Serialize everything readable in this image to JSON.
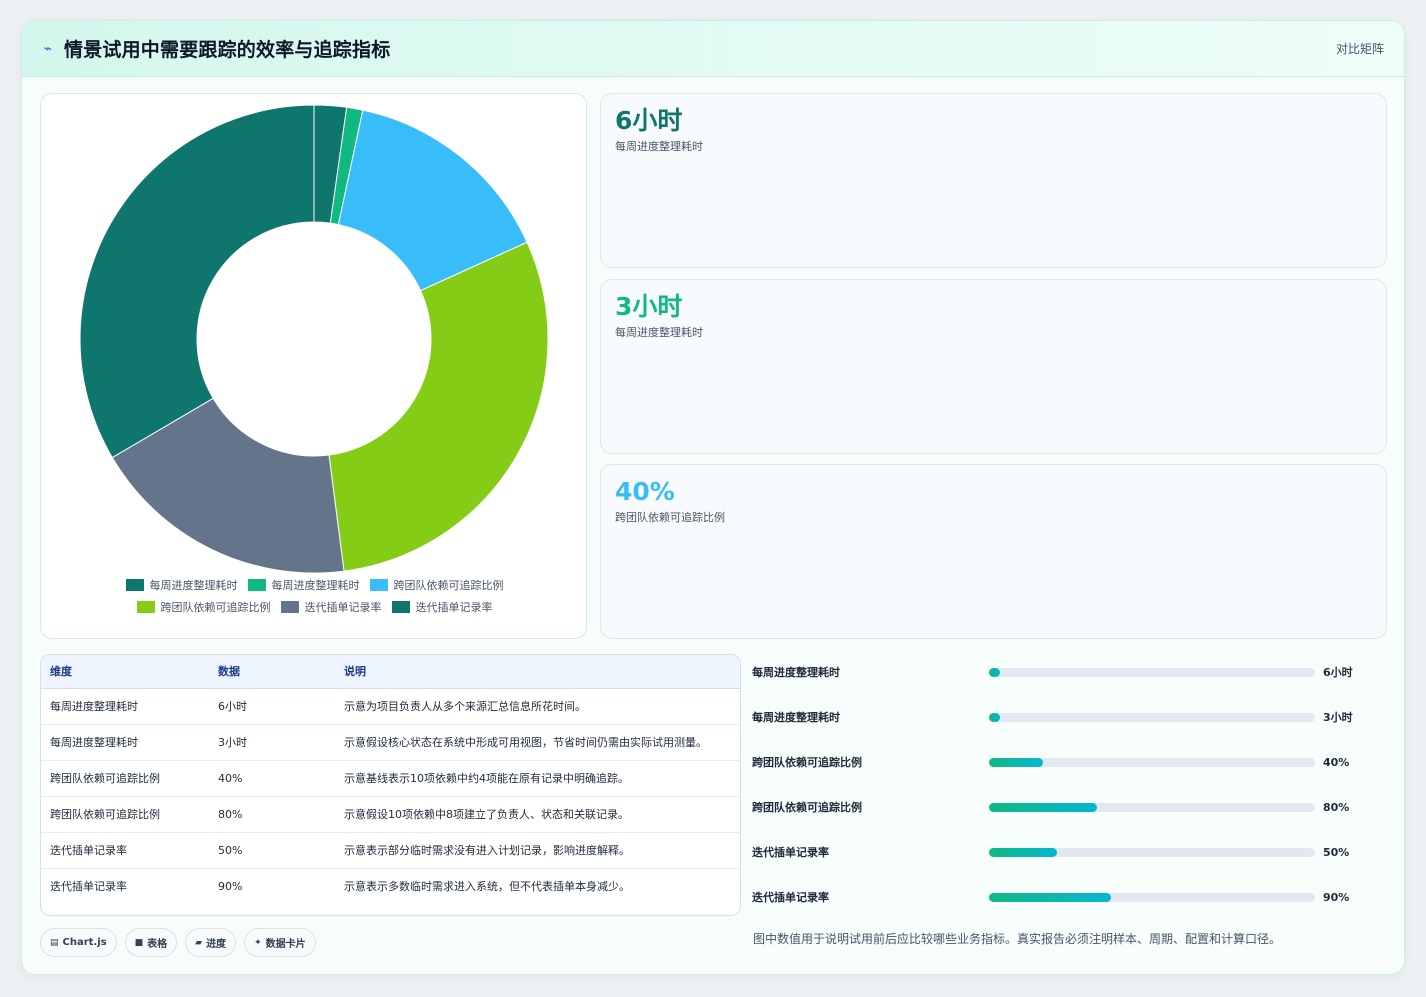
{
  "header": {
    "icon": "bolt-icon",
    "title": "情景试用中需要跟踪的效率与追踪指标",
    "matrix_link": "对比矩阵"
  },
  "colors": {
    "teal_dark": "#0f766e",
    "green": "#10b981",
    "sky": "#38bdf8",
    "lime": "#84cc16",
    "slate": "#64748b",
    "teal": "#0f766e"
  },
  "chart_data": {
    "type": "pie",
    "donut": true,
    "labels": [
      "每周进度整理耗时",
      "每周进度整理耗时",
      "跨团队依赖可追踪比例",
      "跨团队依赖可追踪比例",
      "迭代插单记录率",
      "迭代插单记录率"
    ],
    "values": [
      6,
      3,
      40,
      80,
      50,
      90
    ],
    "colors": [
      "#0f766e",
      "#10b981",
      "#38bdf8",
      "#84cc16",
      "#64748b",
      "#0f766e"
    ],
    "legend_position": "bottom"
  },
  "stats": [
    {
      "value": "6小时",
      "label": "每周进度整理耗时",
      "color": "#0f766e"
    },
    {
      "value": "3小时",
      "label": "每周进度整理耗时",
      "color": "#10b981"
    },
    {
      "value": "40%",
      "label": "跨团队依赖可追踪比例",
      "color": "#38bdf8"
    }
  ],
  "table": {
    "headers": [
      "维度",
      "数据",
      "说明"
    ],
    "rows": [
      [
        "每周进度整理耗时",
        "6小时",
        "示意为项目负责人从多个来源汇总信息所花时间。"
      ],
      [
        "每周进度整理耗时",
        "3小时",
        "示意假设核心状态在系统中形成可用视图，节省时间仍需由实际试用测量。"
      ],
      [
        "跨团队依赖可追踪比例",
        "40%",
        "示意基线表示10项依赖中约4项能在原有记录中明确追踪。"
      ],
      [
        "跨团队依赖可追踪比例",
        "80%",
        "示意假设10项依赖中8项建立了负责人、状态和关联记录。"
      ],
      [
        "迭代插单记录率",
        "50%",
        "示意表示部分临时需求没有进入计划记录，影响进度解释。"
      ],
      [
        "迭代插单记录率",
        "90%",
        "示意表示多数临时需求进入系统，但不代表插单本身减少。"
      ]
    ]
  },
  "progress": [
    {
      "label": "每周进度整理耗时",
      "value": "6小时",
      "fraction": 0.0
    },
    {
      "label": "每周进度整理耗时",
      "value": "3小时",
      "fraction": 0.0
    },
    {
      "label": "跨团队依赖可追踪比例",
      "value": "40%",
      "fraction": 0.165
    },
    {
      "label": "跨团队依赖可追踪比例",
      "value": "80%",
      "fraction": 0.33
    },
    {
      "label": "迭代插单记录率",
      "value": "50%",
      "fraction": 0.21
    },
    {
      "label": "迭代插单记录率",
      "value": "90%",
      "fraction": 0.375
    }
  ],
  "chips": [
    {
      "icon": "chart-icon",
      "glyph": "▤",
      "label": "Chart.js"
    },
    {
      "icon": "table-icon",
      "glyph": "■",
      "label": "表格"
    },
    {
      "icon": "progress-icon",
      "glyph": "▰",
      "label": "进度"
    },
    {
      "icon": "card-icon",
      "glyph": "✦",
      "label": "数据卡片"
    }
  ],
  "footnote": "图中数值用于说明试用前后应比较哪些业务指标。真实报告必须注明样本、周期、配置和计算口径。"
}
